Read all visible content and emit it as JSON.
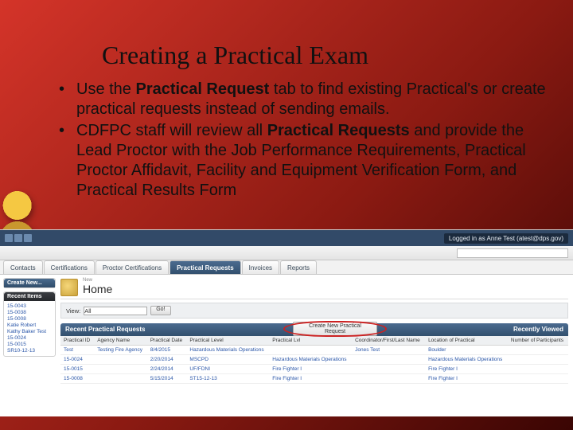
{
  "title": "Creating a Practical Exam",
  "bullets": [
    {
      "pre": "Use the ",
      "b": "Practical Request",
      "post": " tab to find existing Practical's or create practical requests instead of sending emails."
    },
    {
      "pre": "CDFPC staff will review all ",
      "b": "Practical Requests",
      "post": " and provide the Lead Proctor  with the Job Performance Requirements, Practical Proctor Affidavit, Facility and Equipment Verification Form, and Practical Results Form"
    }
  ],
  "sf": {
    "login": "Logged in as Anne Test (atest@dps.gov)",
    "tabs": [
      "Contacts",
      "Certifications",
      "Proctor Certifications",
      "Practical Requests",
      "Invoices",
      "Reports"
    ],
    "activeTab": 3,
    "side_create": "Create New...",
    "side_recent": "Recent Items",
    "recent": [
      "15-0043",
      "15-0038",
      "15-0008",
      "Katie Robert",
      "Kathy Baker Test",
      "15-0024",
      "15-0015",
      "SR10-12-13"
    ],
    "new_label": "New",
    "home": "Home",
    "view": "View:",
    "view_val": "All",
    "go": "Go!",
    "section": "Recent Practical Requests",
    "new_btn": "Create New Practical Request",
    "recently": "Recently Viewed",
    "cols": [
      "Practical ID",
      "Agency Name",
      "Practical Date",
      "Practical Level",
      "Practical Lvl",
      "Coordinator/First/Last Name",
      "Location of Practical",
      "Number of Participants"
    ],
    "rows": [
      [
        "Test",
        "Testing Fire Agency",
        "8/4/2015",
        "Hazardous Materials Operations",
        "",
        "Jones Test",
        "Boulder",
        ""
      ],
      [
        "15-0024",
        "",
        "2/20/2014",
        "MSCPD",
        "Hazardous Materials Operations",
        "",
        "Hazardous Materials Operations",
        ""
      ],
      [
        "15-0015",
        "",
        "2/24/2014",
        "UF/FDNI",
        "Fire Fighter I",
        "",
        "Fire Fighter I",
        ""
      ],
      [
        "15-0008",
        "",
        "5/15/2014",
        "ST15-12-13",
        "Fire Fighter I",
        "",
        "Fire Fighter I",
        ""
      ]
    ]
  }
}
